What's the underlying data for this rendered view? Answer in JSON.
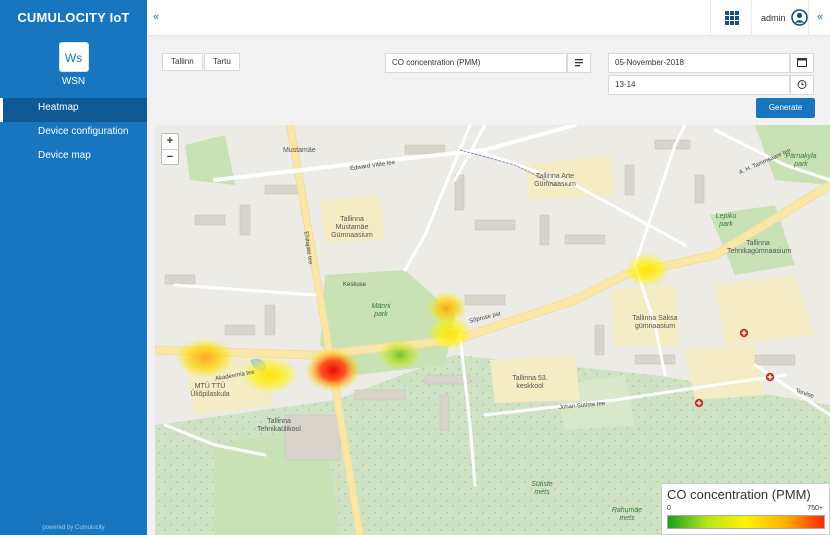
{
  "app": {
    "brand": "CUMULOCITY IoT",
    "tenant_initials": "Ws",
    "tenant_name": "WSN",
    "powered_by": "powered by Cumulocity"
  },
  "sidebar": {
    "items": [
      {
        "label": "Heatmap",
        "active": true
      },
      {
        "label": "Device configuration",
        "active": false
      },
      {
        "label": "Device map",
        "active": false
      }
    ]
  },
  "topbar": {
    "user": "admin",
    "apps_icon": "grid-icon",
    "user_icon": "user-circle-icon",
    "collapse": "«"
  },
  "controls": {
    "city_buttons": [
      "Tallinn",
      "Tartu"
    ],
    "measurement": "CO concentration (PMM)",
    "date": "05-November-2018",
    "time": "13-14",
    "generate_label": "Generate"
  },
  "map": {
    "zoom_in": "+",
    "zoom_out": "−",
    "labels": [
      {
        "text": "Mustamäe"
      },
      {
        "text": "Edward Vilde tee"
      },
      {
        "text": "Tallinna Mustamäe Gümnaasium"
      },
      {
        "text": "Männi park"
      },
      {
        "text": "Sõpruse pst"
      },
      {
        "text": "Ehitajate tee"
      },
      {
        "text": "Tallinna Arte Gümnaasium"
      },
      {
        "text": "Lepiku park"
      },
      {
        "text": "Tallinna Tehnikagümnaasium"
      },
      {
        "text": "Tallinna Saksa gümnaasium"
      },
      {
        "text": "Tallinna 53. keskkool"
      },
      {
        "text": "MTÜ TTÜ Üliõpilaskula"
      },
      {
        "text": "Tallinna Tehnikaülikool"
      },
      {
        "text": "Akadeemia tee"
      },
      {
        "text": "Sütiste mets"
      },
      {
        "text": "Rahumäe mets"
      },
      {
        "text": "Johan Sütiste tee"
      },
      {
        "text": "A. H. Tammsaare tee"
      },
      {
        "text": "Pärnakyla park"
      },
      {
        "text": "Keskuse"
      },
      {
        "text": "Tervise"
      }
    ],
    "hotspots": [
      {
        "level": "medium",
        "color": "#ffb000"
      },
      {
        "level": "medium",
        "color": "#ffd000"
      },
      {
        "level": "high",
        "color": "#ff2a00"
      },
      {
        "level": "low",
        "color": "#8fd11a"
      },
      {
        "level": "medium",
        "color": "#ffe000"
      },
      {
        "level": "medium",
        "color": "#ff9a00"
      },
      {
        "level": "medium",
        "color": "#ffee00"
      }
    ]
  },
  "legend": {
    "title": "CO concentration (PMM)",
    "min": "0",
    "max": "750+"
  }
}
